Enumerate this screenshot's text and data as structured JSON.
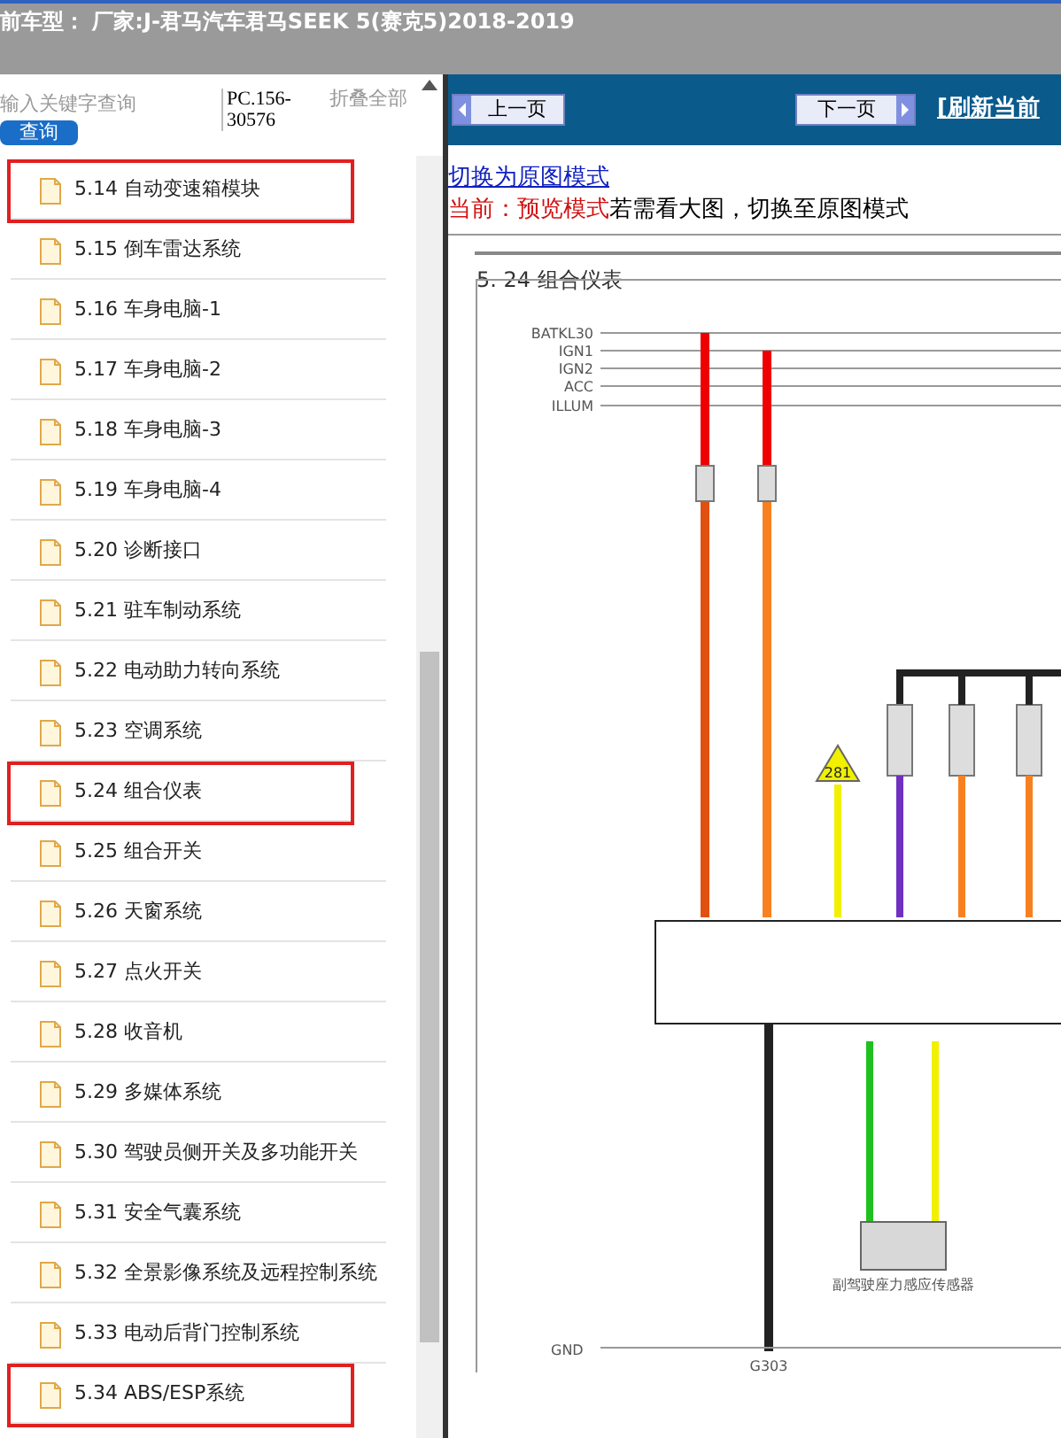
{
  "header": {
    "title": "前车型： 厂家:J-君马汽车君马SEEK 5(赛克5)2018-2019"
  },
  "search": {
    "placeholder": "输入关键字查询",
    "button": "查询",
    "code": "PC.156-30576",
    "collapse": "折叠全部"
  },
  "sidebar": {
    "items": [
      {
        "label": "5.14 自动变速箱模块",
        "highlighted": true
      },
      {
        "label": "5.15 倒车雷达系统",
        "highlighted": false
      },
      {
        "label": "5.16 车身电脑-1",
        "highlighted": false
      },
      {
        "label": "5.17 车身电脑-2",
        "highlighted": false
      },
      {
        "label": "5.18 车身电脑-3",
        "highlighted": false
      },
      {
        "label": "5.19 车身电脑-4",
        "highlighted": false
      },
      {
        "label": "5.20 诊断接口",
        "highlighted": false
      },
      {
        "label": "5.21 驻车制动系统",
        "highlighted": false
      },
      {
        "label": "5.22 电动助力转向系统",
        "highlighted": false
      },
      {
        "label": "5.23 空调系统",
        "highlighted": false
      },
      {
        "label": "5.24 组合仪表",
        "highlighted": true
      },
      {
        "label": "5.25 组合开关",
        "highlighted": false
      },
      {
        "label": "5.26 天窗系统",
        "highlighted": false
      },
      {
        "label": "5.27 点火开关",
        "highlighted": false
      },
      {
        "label": "5.28 收音机",
        "highlighted": false
      },
      {
        "label": "5.29 多媒体系统",
        "highlighted": false
      },
      {
        "label": "5.30 驾驶员侧开关及多功能开关",
        "highlighted": false
      },
      {
        "label": "5.31 安全气囊系统",
        "highlighted": false
      },
      {
        "label": "5.32 全景影像系统及远程控制系统",
        "highlighted": false
      },
      {
        "label": "5.33 电动后背门控制系统",
        "highlighted": false
      },
      {
        "label": "5.34 ABS/ESP系统",
        "highlighted": true
      }
    ]
  },
  "toolbar": {
    "prev": "上一页",
    "next": "下一页",
    "refresh": "[刷新当前"
  },
  "mode": {
    "link": "切换为原图模式",
    "current": "当前：预览模式",
    "hint": "若需看大图，切换至原图模式"
  },
  "diagram": {
    "title": "5. 24  组合仪表",
    "bus_labels": [
      "BATKL30",
      "IGN1",
      "IGN2",
      "ACC",
      "ILLUM"
    ],
    "marker": "281",
    "sensor": "副驾驶座力感应传感器",
    "gnd": "GND",
    "ground": "G303"
  }
}
